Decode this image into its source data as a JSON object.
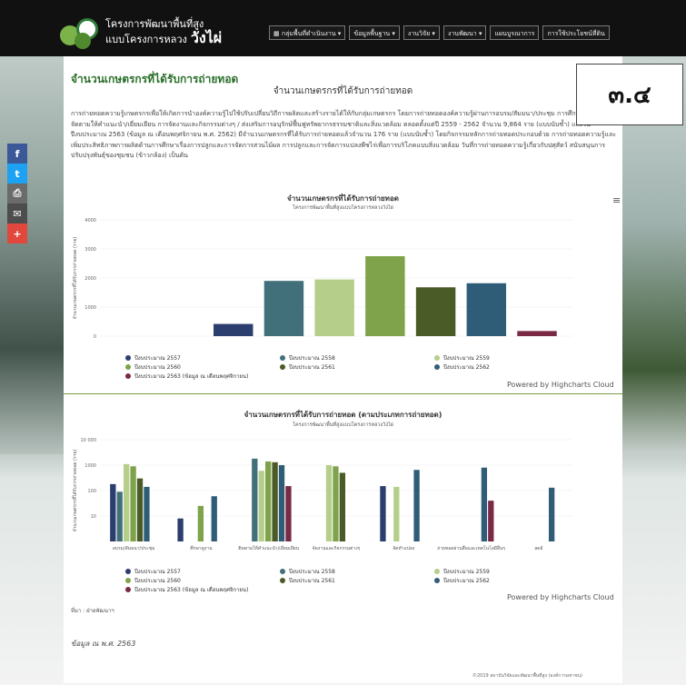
{
  "header": {
    "brand_line1": "โครงการพัฒนาพื้นที่สูง",
    "brand_line2": "แบบโครงการหลวง",
    "brand_big": "วังไผ่",
    "nav": [
      "▦ กลุ่มพื้นที่ดำเนินงาน ▾",
      "ข้อมูลพื้นฐาน ▾",
      "งานวิจัย ▾",
      "งานพัฒนา ▾",
      "แผนบูรณาการ",
      "การใช้ประโยชน์ที่ดิน"
    ]
  },
  "social": [
    "f",
    "t",
    "⎙",
    "✉",
    "+"
  ],
  "section": {
    "title": "จำนวนเกษตรกรที่ได้รับการถ่ายทอด",
    "subtitle": "จำนวนเกษตรกรที่ได้รับการถ่ายทอด",
    "paragraph": "การถ่ายทอดความรู้เกษตรกรเพื่อให้เกิดการนำองค์ความรู้ไปใช้ปรับเปลี่ยนวิถีการผลิตและสร้างรายได้ให้กับกลุ่มเกษตรกร โดยการถ่ายทอดองค์ความรู้ผ่านการอบรม/สัมมนา/ประชุม การศึกษาดูงาน การจัดตามให้คำแนะนำ/เยี่ยมเยียน การจัดงานและกิจกรรมต่างๆ / ส่งเสริมการอนุรักษ์ฟื้นฟูทรัพยากรธรรมชาติและสิ่งแวดล้อม ตลอดตั้งแต่ปี 2559 - 2562 จำนวน 9,864 ราย (แบบนับซ้ำ) และในปีงบประมาณ 2563 (ข้อมูล ณ เดือนพฤศจิกายน พ.ศ. 2562) มีจำนวนเกษตรกรที่ได้รับการถ่ายทอดแล้วจำนวน 176 ราย (แบบนับซ้ำ) โดยกิจกรรมหลักการถ่ายทอดประกอบด้วย การถ่ายทอดความรู้และเพิ่มประสิทธิภาพการผลิตด้านการศึกษาเรื่องการปลูกและการจัดการสวนไม้ผล การปลูกและการจัดการแปลงพืชไร่เพื่อการบริโภคแบบสิ่งแวดล้อม วันที่การถ่ายทอดความรู้เกี่ยวกับปศุสัตว์ สนับสนุนการปรับปรุงพันธุ์ของชุมชน (ข้าวกล้อง) เป็นต้น",
    "stamp": "๓.๔"
  },
  "chart1": {
    "title": "จำนวนเกษตรกรที่ได้รับการถ่ายทอด",
    "subtitle": "โครงการพัฒนาพื้นที่สูงแบบโครงการหลวงวังไผ่",
    "menu_icon": "≡",
    "credits": "Powered by Highcharts Cloud"
  },
  "chart2": {
    "title": "จำนวนเกษตรกรที่ได้รับการถ่ายทอด (ตามประเภทการถ่ายทอด)",
    "subtitle": "โครงการพัฒนาพื้นที่สูงแบบโครงการหลวงวังไผ่",
    "credits": "Powered by Highcharts Cloud"
  },
  "source": "ที่มา : ฝ่ายพัฒนาฯ",
  "date_note": "ข้อมูล ณ พ.ศ. 2563",
  "footer": "©2019 สถาบันวิจัยและพัฒนาพื้นที่สูง (องค์การมหาชน)",
  "colors": {
    "s2557": "#2c3e6e",
    "s2558": "#41707a",
    "s2559": "#b5cf8a",
    "s2560": "#7fa34b",
    "s2561": "#4a5b27",
    "s2562": "#2f5d78",
    "s2563": "#7b2a45"
  },
  "chart_data": [
    {
      "type": "bar",
      "title": "จำนวนเกษตรกรที่ได้รับการถ่ายทอด",
      "subtitle": "โครงการพัฒนาพื้นที่สูงแบบโครงการหลวงวังไผ่",
      "ylabel": "จำนวนเกษตรกรที่ได้รับการถ่ายทอด (ราย)",
      "ylim": [
        0,
        4000
      ],
      "yticks": [
        "4000",
        "3000",
        "2000",
        "1000",
        "0"
      ],
      "series": [
        {
          "name": "ปีงบประมาณ 2557",
          "value": 420,
          "color": "#2c3e6e"
        },
        {
          "name": "ปีงบประมาณ 2558",
          "value": 1900,
          "color": "#41707a"
        },
        {
          "name": "ปีงบประมาณ 2559",
          "value": 1950,
          "color": "#b5cf8a"
        },
        {
          "name": "ปีงบประมาณ 2560",
          "value": 2750,
          "color": "#7fa34b"
        },
        {
          "name": "ปีงบประมาณ 2561",
          "value": 1680,
          "color": "#4a5b27"
        },
        {
          "name": "ปีงบประมาณ 2562",
          "value": 1820,
          "color": "#2f5d78"
        },
        {
          "name": "ปีงบประมาณ 2563 (ข้อมูล ณ เดือนพฤศจิกายน)",
          "value": 176,
          "color": "#7b2a45"
        }
      ],
      "legend": "bottom"
    },
    {
      "type": "bar",
      "title": "จำนวนเกษตรกรที่ได้รับการถ่ายทอด (ตามประเภทการถ่ายทอด)",
      "subtitle": "โครงการพัฒนาพื้นที่สูงแบบโครงการหลวงวังไผ่",
      "ylabel": "จำนวนเกษตรกรที่ได้รับการถ่ายทอด (ราย)",
      "yscale": "log",
      "ylim": [
        1,
        10000
      ],
      "yticks": [
        "10 000",
        "1000",
        "100",
        "10"
      ],
      "categories": [
        "อบรม/สัมมนา/ประชุม",
        "ศึกษาดูงาน",
        "ติดตามให้คำแนะนำ/เยี่ยมเยียน",
        "จัดงานและกิจกรรมต่างๆ",
        "จัดทำแปลง",
        "ถ่ายทอดผ่านสื่อและเทคโนโลยีอื่นๆ",
        "ลดย์"
      ],
      "series": [
        {
          "name": "ปีงบประมาณ 2557",
          "color": "#2c3e6e",
          "values": [
            180,
            8,
            0,
            0,
            150,
            0,
            0
          ]
        },
        {
          "name": "ปีงบประมาณ 2558",
          "color": "#41707a",
          "values": [
            90,
            0,
            1800,
            0,
            0,
            0,
            0
          ]
        },
        {
          "name": "ปีงบประมาณ 2559",
          "color": "#b5cf8a",
          "values": [
            1100,
            0,
            600,
            1000,
            140,
            0,
            0
          ]
        },
        {
          "name": "ปีงบประมาณ 2560",
          "color": "#7fa34b",
          "values": [
            900,
            25,
            1400,
            900,
            0,
            0,
            0
          ]
        },
        {
          "name": "ปีงบประมาณ 2561",
          "color": "#4a5b27",
          "values": [
            300,
            0,
            1300,
            500,
            0,
            0,
            0
          ]
        },
        {
          "name": "ปีงบประมาณ 2562",
          "color": "#2f5d78",
          "values": [
            140,
            60,
            1000,
            0,
            650,
            800,
            130
          ]
        },
        {
          "name": "ปีงบประมาณ 2563 (ข้อมูล ณ เดือนพฤศจิกายน)",
          "color": "#7b2a45",
          "values": [
            0,
            0,
            150,
            0,
            0,
            40,
            0
          ]
        }
      ],
      "legend": "bottom"
    }
  ]
}
